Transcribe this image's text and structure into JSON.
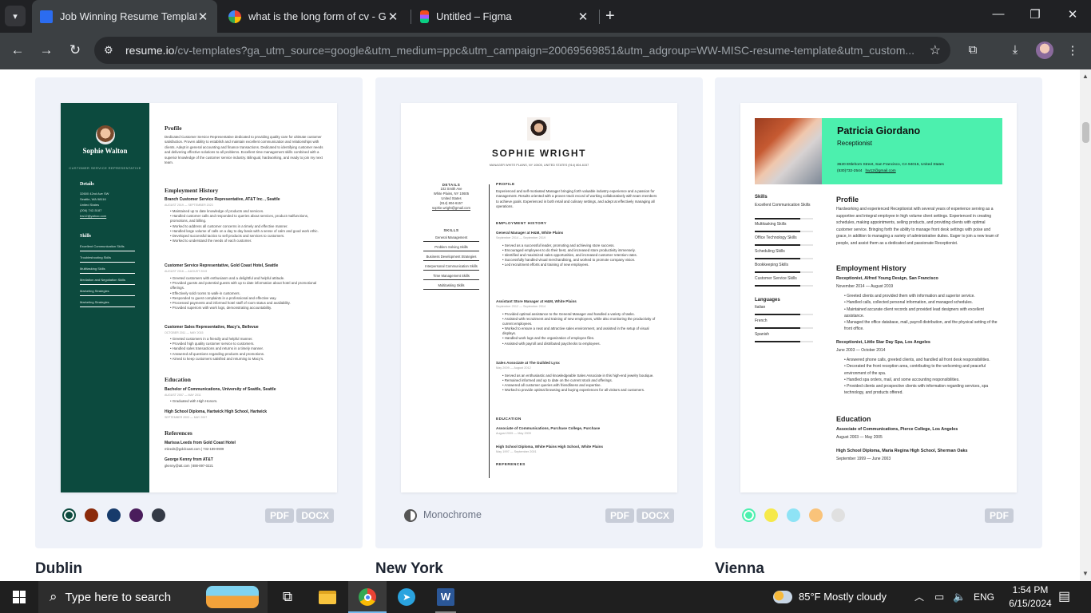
{
  "browser": {
    "tabs": [
      {
        "title": "Job Winning Resume Templates",
        "favicon": "resume-io-icon",
        "active": true
      },
      {
        "title": "what is the long form of cv - Go",
        "favicon": "google-icon",
        "active": false
      },
      {
        "title": "Untitled – Figma",
        "favicon": "figma-icon",
        "active": false
      }
    ],
    "url_host": "resume.io",
    "url_path": "/cv-templates?ga_utm_source=google&utm_medium=ppc&utm_campaign=20069569851&utm_adgroup=WW-MISC-resume-template&utm_custom..."
  },
  "templates": [
    {
      "name": "Dublin",
      "colors": [
        "#0c4a3e",
        "#8b2a0a",
        "#173b6b",
        "#4a1d5c",
        "#343a46"
      ],
      "formats": [
        "PDF",
        "DOCX"
      ],
      "resume": {
        "name": "Sophie Walton",
        "role": "CUSTOMER SERVICE REPRESENTATIVE",
        "details_title": "Details",
        "details": [
          "32600 42nd Ave SW",
          "Seattle, WA 98116",
          "United States",
          "(206) 742-5187",
          "hw12@yahoo.com"
        ],
        "skills_title": "Skills",
        "skills": [
          "Excellent Communication Skills",
          "Troubleshooting Skills",
          "Multitasking Skills",
          "Mediation and Negotiation Skills",
          "Marketing Strategies",
          "Marketing Strategies"
        ],
        "profile_title": "Profile",
        "profile": "Dedicated Customer Service Representative dedicated to providing quality care for ultimate customer satisfaction. Proven ability to establish and maintain excellent communication and relationships with clients. Adept in general accounting and finance transactions. Dedicated to identifying customer needs and delivering effective solutions to all problems. Excellent time management skills combined with a superior knowledge of the customer service industry. Bilingual, hardworking, and ready to join my next team.",
        "employment_title": "Employment History",
        "jobs": [
          {
            "title": "Branch Customer Service Representative, AT&T Inc. , Seattle",
            "dates": "AUGUST 2019 — SEPTEMBER 2023",
            "bullets": [
              "Maintained up to date knowledge of products and services.",
              "Handled customer calls and responded to queries about services, product malfunctions, promotions, and billing.",
              "Worked to address all customer concerns in a timely and effective manner.",
              "Handled large volume of calls on a day to day basis with a sense of calm and good work ethic.",
              "Developed successful tactics to sell products and services to customers.",
              "Worked to understand the needs of each customer."
            ]
          },
          {
            "title": "Customer Service Representative, Gold Coast Hotel, Seattle",
            "dates": "AUGUST 2016 — AUGUST 2019",
            "bullets": [
              "Greeted customers with enthusiasm and a delightful and helpful attitude.",
              "Provided guests and potential guests with up to date information about hotel and promotional offerings.",
              "Effectively sold rooms to walk-in customers.",
              "Responded to guest complaints in a professional and effective way.",
              "Processed payments and informed hotel staff of room status and availability.",
              "Provided superiors with work logs, demonstrating accountability."
            ]
          },
          {
            "title": "Customer Sales Representative, Macy's, Bellevue",
            "dates": "OCTOBER 2011 — MAY 2015",
            "bullets": [
              "Greeted customers in a friendly and helpful manner.",
              "Provided high quality customer service to customers.",
              "Handled sales transactions and returns in a timely manner.",
              "Answered all questions regarding products and promotions.",
              "Aimed to keep customers satisfied and returning to Macy's."
            ]
          }
        ],
        "education_title": "Education",
        "education": [
          {
            "title": "Bachelor of Communications, University of Seattle, Seattle",
            "dates": "AUGUST 2007 — MAY 2011",
            "bullet": "Graduated with High Honors."
          },
          {
            "title": "High School Diploma, Hartwick High School, Hartwick",
            "dates": "SEPTEMBER 2003 — MAY 2007"
          }
        ],
        "references_title": "References",
        "references": [
          {
            "name": "Marissa Leeds from Gold Coast Hotel",
            "contact": "mleeds@goldcoast.com  |  732-189-0909"
          },
          {
            "name": "George Kenny from AT&T",
            "contact": "gkenny@att.com  |  888-897-0221"
          }
        ]
      }
    },
    {
      "name": "New York",
      "variant": "Monochrome",
      "formats": [
        "PDF",
        "DOCX"
      ],
      "resume": {
        "name": "SOPHIE WRIGHT",
        "contact": "MANAGER   WHITE PLAINS, NY 10605, UNITED STATES   (914) 804-6157",
        "details_title": "DETAILS",
        "details": [
          "102 Smith Ave",
          "White Plains, NY 10605",
          "United States",
          "(914) 804-6157",
          "sophie.wright@gmail.com"
        ],
        "skills_title": "SKILLS",
        "skills": [
          "General Management",
          "Problem Solving Skills",
          "Business Development Strategies",
          "Interpersonal Communication Skills",
          "Time Management Skills",
          "Multitasking Skills"
        ],
        "profile_title": "PROFILE",
        "profile": "Experienced and self-motivated Manager bringing forth valuable industry experience and a passion for management. Results oriented with a proven track record of working collaboratively with team members to achieve goals. Experienced in both retail and culinary settings, and adept at effectively managing all operations.",
        "employment_title": "EMPLOYMENT HISTORY",
        "jobs": [
          {
            "title": "General Manager at H&M, White Plains",
            "dates": "September 2014 — September 2019",
            "bullets": [
              "Served as a successful leader, promoting and achieving store success.",
              "Encouraged employees to do their best, and increased store productivity immensely.",
              "Identified and maximized sales opportunities, and increased customer retention rates.",
              "Successfully handled visual merchandising, and worked to promote company vision.",
              "Led recruitment efforts and training of new employees."
            ]
          },
          {
            "title": "Assistant Store Manager at H&M, White Plains",
            "dates": "September 2012 — September 2014",
            "bullets": [
              "Provided optimal assistance to the General Manager and handled a variety of tasks.",
              "Assisted with recruitment and training of new employees, while also monitoring the productivity of current employees.",
              "Worked to ensure a neat and attractive sales environment, and assisted in the setup of visual displays.",
              "Handled work logs and the organization of employee files.",
              "Assisted with payroll and distributed paychecks to employees."
            ]
          },
          {
            "title": "Sales Associate at The Guilded Lynx",
            "dates": "May 2009 — August 2012",
            "bullets": [
              "Served as an enthusiastic and knowledgeable Sales Associate in this high-end jewelry boutique.",
              "Remained informed and up to date on the current stock and offerings.",
              "Answered all customer queries with friendliness and expertise.",
              "Worked to provide optimal browsing and buying experiences for all visitors and customers."
            ]
          }
        ],
        "education_title": "EDUCATION",
        "education": [
          {
            "title": "Associate of Communications, Purchase College, Purchase",
            "dates": "August 2005 — May 2009"
          },
          {
            "title": "High School Diploma, White Plains High School, White Plains",
            "dates": "May 1997 — September 2001"
          }
        ],
        "references_title": "REFERENCES"
      }
    },
    {
      "name": "Vienna",
      "colors": [
        "#4cf0ae",
        "#f6e94a",
        "#8ee3f5",
        "#f9c37a",
        "#e0e0e0"
      ],
      "formats": [
        "PDF"
      ],
      "resume": {
        "name": "Patricia Giordano",
        "role": "Receptionist",
        "address": "3620 Ettlehorn Street, San Francisco, CA 94016, United States",
        "phone": "(530)732-2544",
        "email": "hw12@gmail.com",
        "skills_title": "Skills",
        "skills": [
          "Excellent Communication Skills",
          "Multitasking Skills",
          "Office Technology Skills",
          "Scheduling Skills",
          "Bookkeeping Skills",
          "Customer Service Skills"
        ],
        "languages_title": "Languages",
        "languages": [
          "Italian",
          "French",
          "Spanish"
        ],
        "profile_title": "Profile",
        "profile": "Hardworking and experienced Receptionist with several years of experience serving as a supportive and integral employee in high volume client settings. Experienced in creating schedules, making appointments, selling products, and providing clients with optimal customer service. Bringing forth the ability to manage front desk settings with poise and grace, in addition to managing a variety of administrative duties. Eager to join a new team of people, and assist them as a dedicated and passionate Receptionist.",
        "employment_title": "Employment History",
        "jobs": [
          {
            "title": "Receptionist, Alfred Young Design, San Francisco",
            "dates": "November 2014 — August 2019",
            "bullets": [
              "Greeted clients and provided them with information and superior service.",
              "Handled calls, collected personal information, and managed schedules.",
              "Maintained accurate client records and provided lead designers with excellent assistance.",
              "Managed the office database, mail, payroll distribution, and the physical setting of the front office."
            ]
          },
          {
            "title": "Receptionist, Little Star Day Spa, Los Angeles",
            "dates": "June 2003 — October 2014",
            "bullets": [
              "Answered phone calls, greeted clients, and handled all front desk responsibilities.",
              "Decorated the front reception area, contributing to the welcoming and peaceful environment of the spa.",
              "Handled spa orders, mail, and some accounting responsibilities.",
              "Provided clients and prospective clients with information regarding services, spa technology, and products offered."
            ]
          }
        ],
        "education_title": "Education",
        "education": [
          {
            "title": "Associate of Communications, Pierce College, Los Angeles",
            "dates": "August 2003 — May 2005"
          },
          {
            "title": "High School Diploma, Maria Regina High School, Sherman Oaks",
            "dates": "September 1999 — June 2003"
          }
        ]
      }
    }
  ],
  "taskbar": {
    "search_placeholder": "Type here to search",
    "weather": "85°F  Mostly cloudy",
    "language": "ENG",
    "time": "1:54 PM",
    "date": "6/15/2024"
  }
}
